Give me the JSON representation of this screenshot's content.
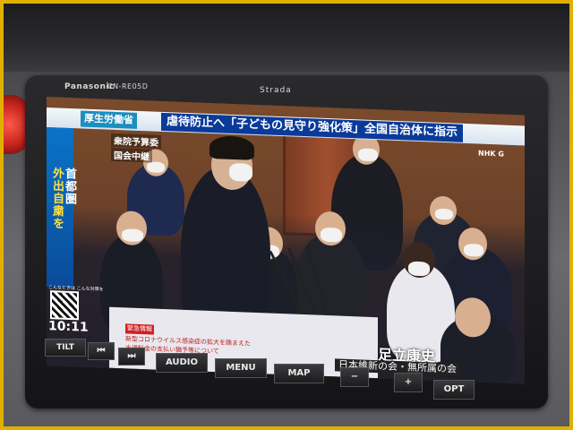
{
  "device": {
    "brand": "Panasonic",
    "model": "CN-RE05D",
    "series": "Strada"
  },
  "tv": {
    "ministry_tag": "厚生労働省",
    "headline": "虐待防止へ「子どもの見守り強化策」全国自治体に指示",
    "channel": "NHK G",
    "sub_tag_1": "衆院予算委",
    "sub_tag_2": "国会中継",
    "sidebar_line_1": "首都圏",
    "sidebar_line_2": "外出自粛を",
    "qr_caption": "こんなときは こんな対策を",
    "clock": "10:11",
    "news_urgent": "緊急情報",
    "news_line_1": "新型コロナウイルス感染症の拡大を踏まえた",
    "news_line_2": "水道料金の支払い猶予等について",
    "speaker_name": "足立康史",
    "speaker_party": "日本維新の会・無所属の会"
  },
  "buttons": {
    "tilt": "TILT",
    "prev": "⏮",
    "next": "⏭",
    "audio": "AUDIO",
    "menu": "MENU",
    "map": "MAP",
    "minus": "−",
    "plus": "+",
    "opt": "OPT"
  },
  "colors": {
    "headline_bg": "#0a3a9a",
    "ministry_bg": "#1a8fc0",
    "sidebar_bg": "#0a74c6",
    "frame": "#e0b000"
  }
}
